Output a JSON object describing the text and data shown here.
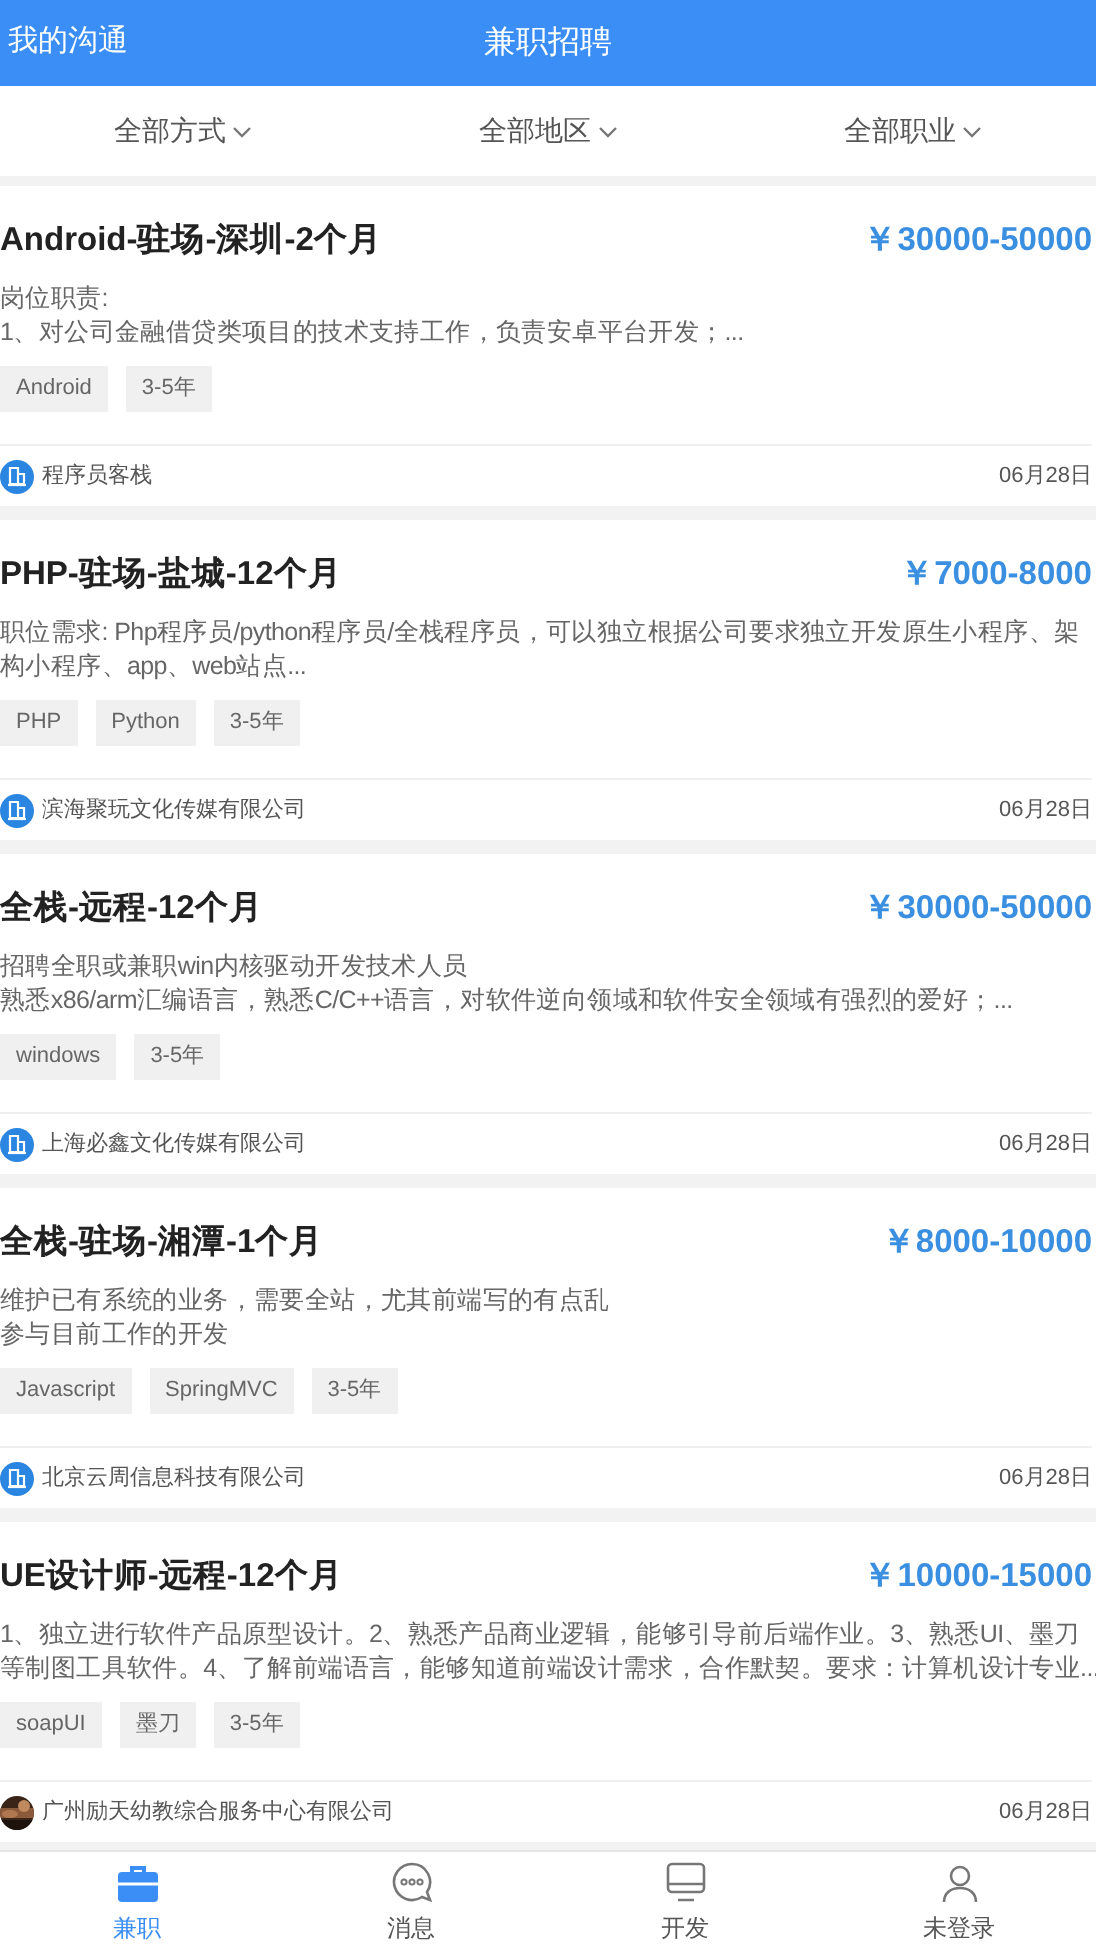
{
  "header": {
    "left_link": "我的沟通",
    "title": "兼职招聘"
  },
  "filters": [
    {
      "label": "全部方式"
    },
    {
      "label": "全部地区"
    },
    {
      "label": "全部职业"
    }
  ],
  "jobs": [
    {
      "title": "Android-驻场-深圳-2个月",
      "salary": "￥30000-50000",
      "description_lines": [
        "岗位职责:",
        "1、对公司金融借贷类项目的技术支持工作，负责安卓平台开发；..."
      ],
      "tags": [
        "Android",
        "3-5年"
      ],
      "company": {
        "name": "程序员客栈",
        "kind": "building"
      },
      "date": "06月28日"
    },
    {
      "title": "PHP-驻场-盐城-12个月",
      "salary": "￥7000-8000",
      "description_lines": [
        "职位需求: Php程序员/python程序员/全栈程序员，可以独立根据公司要求独立开发原生小程序、架",
        "构小程序、app、web站点..."
      ],
      "tags": [
        "PHP",
        "Python",
        "3-5年"
      ],
      "company": {
        "name": "滨海聚玩文化传媒有限公司",
        "kind": "building"
      },
      "date": "06月28日"
    },
    {
      "title": "全栈-远程-12个月",
      "salary": "￥30000-50000",
      "description_lines": [
        "招聘全职或兼职win内核驱动开发技术人员",
        "熟悉x86/arm汇编语言，熟悉C/C++语言，对软件逆向领域和软件安全领域有强烈的爱好；..."
      ],
      "tags": [
        "windows",
        "3-5年"
      ],
      "company": {
        "name": "上海必鑫文化传媒有限公司",
        "kind": "building"
      },
      "date": "06月28日"
    },
    {
      "title": "全栈-驻场-湘潭-1个月",
      "salary": "￥8000-10000",
      "description_lines": [
        "维护已有系统的业务，需要全站，尤其前端写的有点乱",
        "参与目前工作的开发"
      ],
      "tags": [
        "Javascript",
        "SpringMVC",
        "3-5年"
      ],
      "company": {
        "name": "北京云周信息科技有限公司",
        "kind": "building"
      },
      "date": "06月28日"
    },
    {
      "title": "UE设计师-远程-12个月",
      "salary": "￥10000-15000",
      "description_lines": [
        "1、独立进行软件产品原型设计。2、熟悉产品商业逻辑，能够引导前后端作业。3、熟悉UI、墨刀",
        "等制图工具软件。4、了解前端语言，能够知道前端设计需求，合作默契。要求：计算机设计专业..."
      ],
      "tags": [
        "soapUI",
        "墨刀",
        "3-5年"
      ],
      "company": {
        "name": "广州励天幼教综合服务中心有限公司",
        "kind": "picture"
      },
      "date": "06月28日"
    }
  ],
  "tabbar": [
    {
      "label": "兼职",
      "selected": true
    },
    {
      "label": "消息",
      "selected": false
    },
    {
      "label": "开发",
      "selected": false
    },
    {
      "label": "未登录",
      "selected": false
    }
  ]
}
